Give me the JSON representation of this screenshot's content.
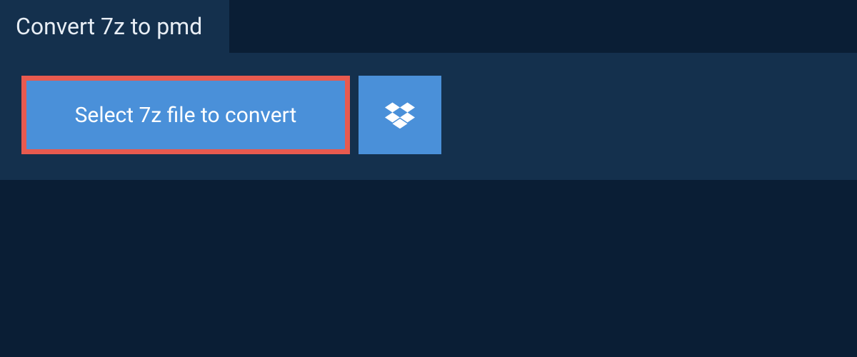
{
  "tab": {
    "title": "Convert 7z to pmd"
  },
  "actions": {
    "select_label": "Select 7z file to convert"
  },
  "colors": {
    "background": "#0a1e35",
    "panel": "#14304d",
    "button": "#4a90d9",
    "highlight_border": "#e85a4f",
    "text_light": "#ffffff"
  }
}
